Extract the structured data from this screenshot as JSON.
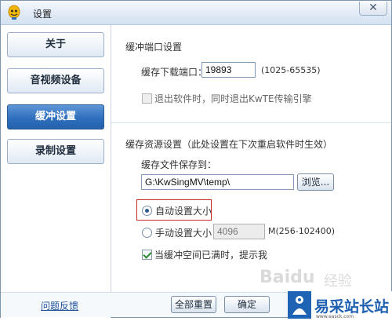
{
  "window": {
    "title": "设置",
    "close_glyph": "✕"
  },
  "sidebar": {
    "items": [
      {
        "label": "关于",
        "active": false
      },
      {
        "label": "音视频设备",
        "active": false
      },
      {
        "label": "缓冲设置",
        "active": true
      },
      {
        "label": "录制设置",
        "active": false
      }
    ]
  },
  "buffer_port": {
    "section_title": "缓冲端口设置",
    "port_label": "缓存下载端口：",
    "port_value": "19893",
    "port_range": "(1025-65535)",
    "exit_checkbox_label": "退出软件时，同时退出KwTE传输引擎",
    "exit_checked": false
  },
  "buffer_resource": {
    "section_title": "缓存资源设置（此处设置在下次重启软件时生效）",
    "save_to_label": "缓存文件保存到：",
    "path_value": "G:\\KwSingMV\\temp\\",
    "browse_label": "浏览...",
    "auto_size_label": "自动设置大小",
    "auto_selected": true,
    "manual_size_label": "手动设置大小",
    "manual_value": "4096",
    "manual_unit_range": "M(256-102400)",
    "notify_label": "当缓冲空间已满时，提示我",
    "notify_checked": true
  },
  "footer": {
    "feedback_link": "问题反馈",
    "reset_all_label": "全部重置",
    "ok_label": "确定"
  },
  "watermark": {
    "text": "Baidu",
    "sub": "经验"
  },
  "brand": {
    "name": "易采站长站",
    "url": "www.easck.com"
  },
  "colors": {
    "accent": "#2f6fbd",
    "highlight": "#c62828",
    "brand": "#1d5fb0"
  }
}
